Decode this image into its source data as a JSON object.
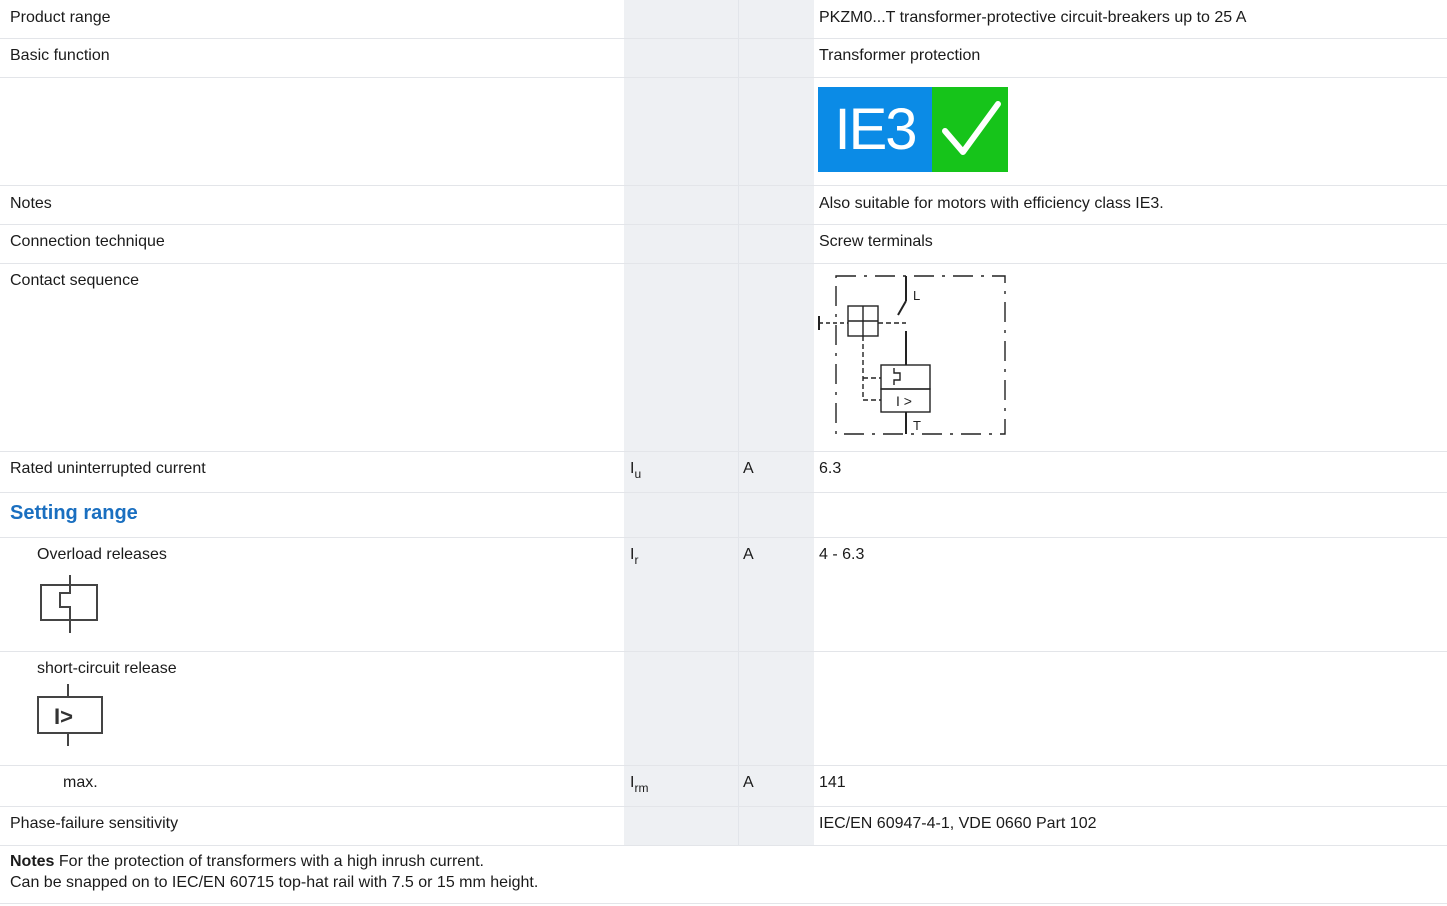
{
  "rows": {
    "product_range": {
      "label": "Product range",
      "value": "PKZM0...T transformer-protective circuit-breakers up to 25 A"
    },
    "basic_function": {
      "label": "Basic function",
      "value": "Transformer protection"
    },
    "ie3_badge": {
      "text": "IE3",
      "icon": "checkmark-icon",
      "colors": {
        "ie": "#0b8be6",
        "check": "#16c41a"
      }
    },
    "notes": {
      "label": "Notes",
      "value": "Also suitable for motors with efficiency class IE3."
    },
    "connection": {
      "label": "Connection technique",
      "value": "Screw terminals"
    },
    "contact_sequence": {
      "label": "Contact sequence",
      "diagram": {
        "top_label": "L",
        "bottom_label": "T",
        "release_label": "I >"
      }
    },
    "rated_current": {
      "label": "Rated uninterrupted current",
      "symbol": "I",
      "symbol_sub": "u",
      "unit": "A",
      "value": "6.3"
    },
    "setting_range": {
      "title": "Setting range"
    },
    "overload": {
      "label": "Overload releases",
      "symbol": "I",
      "symbol_sub": "r",
      "unit": "A",
      "value": "4 - 6.3",
      "icon": "overload-release-icon"
    },
    "short_circuit": {
      "label": "short-circuit release",
      "icon": "short-circuit-release-icon",
      "icon_text": "I>"
    },
    "max": {
      "label": "max.",
      "symbol": "I",
      "symbol_sub": "rm",
      "unit": "A",
      "value": "141"
    },
    "phase_failure": {
      "label": "Phase-failure sensitivity",
      "value": "IEC/EN 60947-4-1, VDE 0660 Part 102"
    }
  },
  "footer_notes": {
    "heading": "Notes",
    "line1": "For the protection of transformers with a high inrush current.",
    "line2": "Can be snapped on to IEC/EN 60715 top-hat rail with 7.5 or 15 mm height."
  },
  "colors": {
    "section_title": "#1a6fc0",
    "grey_column": "#eef0f3",
    "divider": "#e3e5e9"
  }
}
